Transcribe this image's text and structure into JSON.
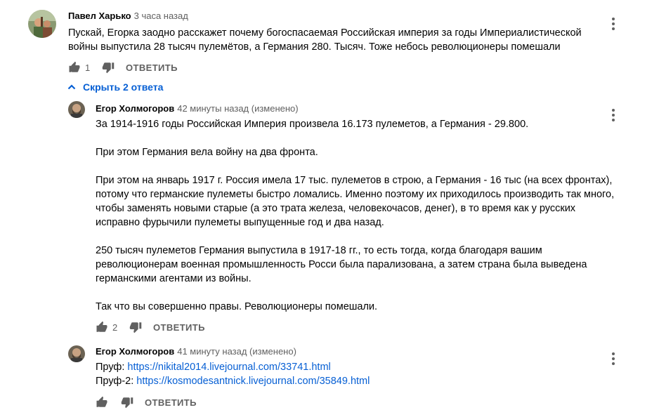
{
  "top_comment": {
    "author": "Павел Харько",
    "timestamp": "3 часа назад",
    "text": "Пускай, Егорка заодно расскажет почему богоспасаемая Российская империя за годы Империалистической войны выпустила 28 тысяч пулемётов, а Германия 280. Тысяч. Тоже небось революционеры помешали",
    "likes": "1",
    "reply_label": "ОТВЕТИТЬ"
  },
  "toggle_replies_label": "Скрыть 2 ответа",
  "replies": [
    {
      "author": "Егор Холмогоров",
      "timestamp": "42 минуты назад (изменено)",
      "paragraphs": [
        "За 1914-1916 годы Российская Империя произвела 16.173 пулеметов, а Германия - 29.800.",
        "При этом Германия вела войну на два фронта.",
        "При этом на январь 1917 г. Россия имела 17 тыс. пулеметов в строю, а Германия - 16 тыс (на всех фронтах), потому что германские пулеметы быстро ломались. Именно поэтому их приходилось производить так много, чтобы заменять новыми старые (а это трата железа, человекочасов, денег), в то время как у русских исправно фурычили пулеметы выпущенные год и два назад.",
        "250 тысяч пулеметов Германия выпустила в 1917-18 гг., то есть тогда, когда благодаря вашим революционерам военная промышленность Росси была парализована, а затем страна была выведена германскими агентами из войны.",
        "Так что вы совершенно правы. Революционеры помешали."
      ],
      "likes": "2",
      "reply_label": "ОТВЕТИТЬ"
    },
    {
      "author": "Егор Холмогоров",
      "timestamp": "41 минуту назад (изменено)",
      "lines": [
        {
          "prefix": "Пруф: ",
          "link": "https://nikital2014.livejournal.com/33741.html"
        },
        {
          "prefix": "Пруф-2: ",
          "link": "https://kosmodesantnick.livejournal.com/35849.html"
        }
      ],
      "likes": "",
      "reply_label": "ОТВЕТИТЬ"
    }
  ],
  "icons": {
    "menu": "more-vert-icon",
    "like": "thumb-up-icon",
    "dislike": "thumb-down-icon",
    "collapse": "chevron-up-icon"
  },
  "colors": {
    "text": "#030303",
    "secondary": "#606060",
    "link": "#065fd4"
  }
}
